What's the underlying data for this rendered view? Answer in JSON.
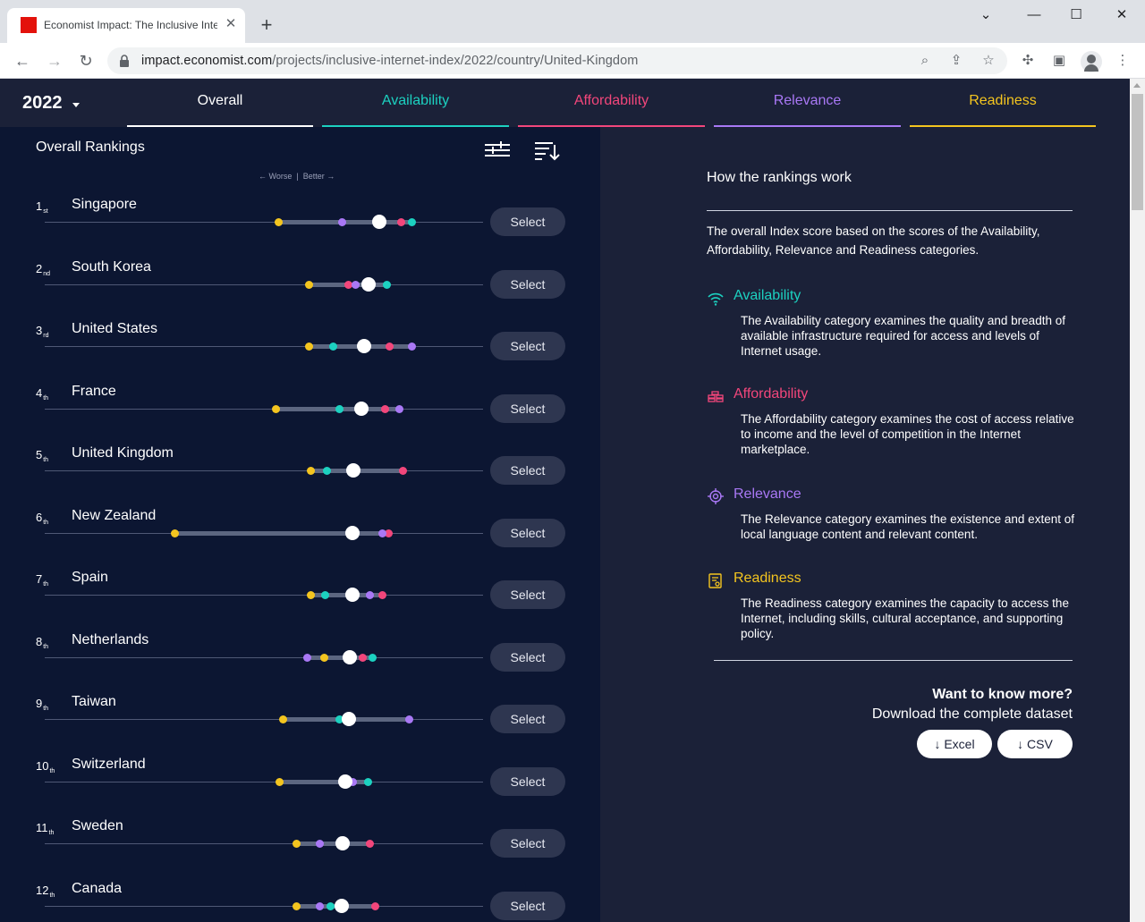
{
  "browser": {
    "tab_title": "Economist Impact: The Inclusive Internet Index",
    "url_host": "impact.economist.com",
    "url_path": "/projects/inclusive-internet-index/2022/country/United-Kingdom",
    "window_controls": {
      "minimize": "—",
      "maximize": "☐",
      "close": "✕"
    }
  },
  "header": {
    "year": "2022",
    "tabs": [
      {
        "label": "Overall",
        "color": "#ffffff"
      },
      {
        "label": "Availability",
        "color": "#1cd1c0"
      },
      {
        "label": "Affordability",
        "color": "#f2467b"
      },
      {
        "label": "Relevance",
        "color": "#a978f5"
      },
      {
        "label": "Readiness",
        "color": "#f4c51f"
      }
    ]
  },
  "rankings": {
    "title": "Overall Rankings",
    "worse": "← Worse",
    "better": "Better →",
    "select_label": "Select",
    "colors": {
      "availability": "#1cd1c0",
      "affordability": "#f2467b",
      "relevance": "#a978f5",
      "readiness": "#f4c51f"
    },
    "rows": [
      {
        "rank": "1",
        "suffix": "st",
        "name": "Singapore",
        "overall": 0.858,
        "availability": 0.903,
        "affordability": 0.888,
        "relevance": 0.807,
        "readiness": 0.72
      },
      {
        "rank": "2",
        "suffix": "nd",
        "name": "South Korea",
        "overall": 0.843,
        "availability": 0.868,
        "affordability": 0.816,
        "relevance": 0.825,
        "readiness": 0.762
      },
      {
        "rank": "3",
        "suffix": "rd",
        "name": "United States",
        "overall": 0.837,
        "availability": 0.795,
        "affordability": 0.872,
        "relevance": 0.903,
        "readiness": 0.762
      },
      {
        "rank": "4",
        "suffix": "th",
        "name": "France",
        "overall": 0.833,
        "availability": 0.804,
        "affordability": 0.866,
        "relevance": 0.885,
        "readiness": 0.716
      },
      {
        "rank": "5",
        "suffix": "th",
        "name": "United Kingdom",
        "overall": 0.822,
        "availability": 0.786,
        "affordability": 0.89,
        "relevance": 0.822,
        "readiness": 0.764
      },
      {
        "rank": "6",
        "suffix": "th",
        "name": "New Zealand",
        "overall": 0.821,
        "availability": 0.821,
        "affordability": 0.871,
        "relevance": 0.862,
        "readiness": 0.578
      },
      {
        "rank": "7",
        "suffix": "th",
        "name": "Spain",
        "overall": 0.821,
        "availability": 0.784,
        "affordability": 0.862,
        "relevance": 0.845,
        "readiness": 0.764
      },
      {
        "rank": "8",
        "suffix": "th",
        "name": "Netherlands",
        "overall": 0.818,
        "availability": 0.849,
        "affordability": 0.835,
        "relevance": 0.759,
        "readiness": 0.783
      },
      {
        "rank": "9",
        "suffix": "th",
        "name": "Taiwan",
        "overall": 0.816,
        "availability": 0.804,
        "affordability": 0.818,
        "relevance": 0.899,
        "readiness": 0.726
      },
      {
        "rank": "10",
        "suffix": "th",
        "name": "Switzerland",
        "overall": 0.811,
        "availability": 0.843,
        "affordability": 0.816,
        "relevance": 0.822,
        "readiness": 0.722
      },
      {
        "rank": "11",
        "suffix": "th",
        "name": "Sweden",
        "overall": 0.808,
        "availability": 0.808,
        "affordability": 0.845,
        "relevance": 0.776,
        "readiness": 0.745
      },
      {
        "rank": "12",
        "suffix": "th",
        "name": "Canada",
        "overall": 0.806,
        "availability": 0.791,
        "affordability": 0.853,
        "relevance": 0.776,
        "readiness": 0.745
      }
    ]
  },
  "info": {
    "title": "How the rankings work",
    "intro": "The overall Index score based on the scores of the Availability, Affordability, Relevance and Readiness categories.",
    "categories": [
      {
        "name": "Availability",
        "icon": "wifi-icon",
        "color": "#1cd1c0",
        "desc": "The Availability category examines the quality and breadth of available infrastructure required for access and levels of Internet usage."
      },
      {
        "name": "Affordability",
        "icon": "coins-icon",
        "color": "#f2467b",
        "desc": "The Affordability category examines the cost of access relative to income and the level of competition in the Internet marketplace."
      },
      {
        "name": "Relevance",
        "icon": "target-icon",
        "color": "#a978f5",
        "desc": "The Relevance category examines the existence and extent of local language content and relevant content."
      },
      {
        "name": "Readiness",
        "icon": "certificate-icon",
        "color": "#f4c51f",
        "desc": "The Readiness category examines the capacity to access the Internet, including skills, cultural acceptance, and supporting policy."
      }
    ],
    "want_more": "Want to know more?",
    "download": "Download the complete dataset",
    "excel": "↓ Excel",
    "csv": "↓ CSV"
  }
}
